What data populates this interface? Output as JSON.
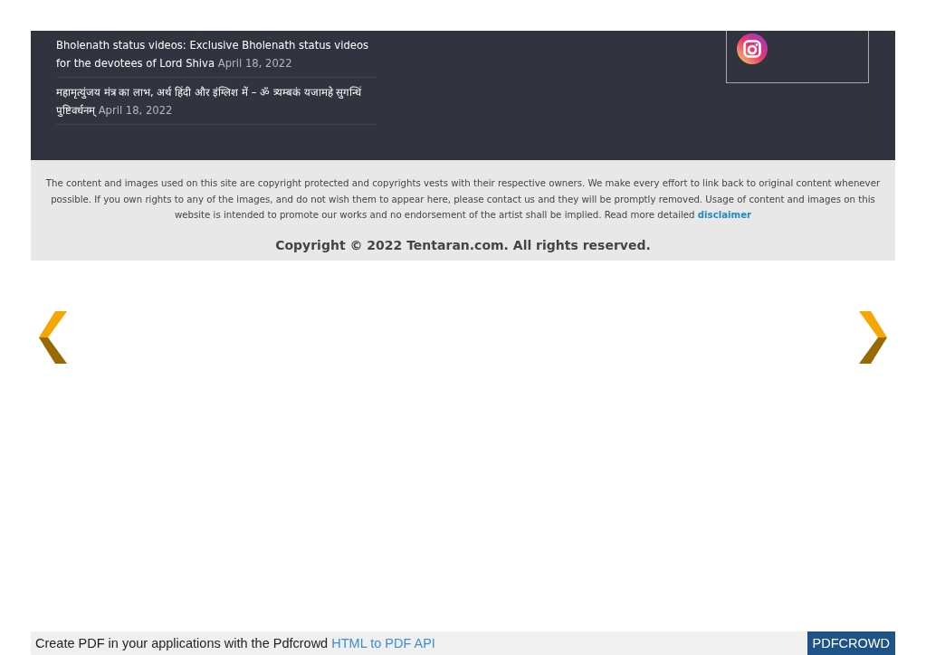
{
  "recent_posts": [
    {
      "title": "Bholenath status videos: Exclusive Bholenath status videos for the devotees of Lord Shiva",
      "date": "April 18, 2022"
    },
    {
      "title": "महामृत्युंजय मंत्र का लाभ, अर्थ हिंदी और इंग्लिश में – ॐ त्र्यम्बकं यजामहे सुगन्धिं पुष्टिवर्धनम्",
      "date": "April 18, 2022"
    }
  ],
  "disclaimer": {
    "text": "The content and images used on this site are copyright protected and copyrights vests with their respective owners. We make every effort to link back to original content whenever possible. If you own rights to any of the images, and do not wish them to appear here, please contact us and they will be promptly removed. Usage of content and images on this website is intended to promote our works and no endorsement of the artist shall be implied. Read more detailed",
    "link": "disclaimer"
  },
  "copyright": "Copyright © 2022 Tentaran.com. All rights reserved.",
  "pdf_bar": {
    "text": "Create PDF in your applications with the Pdfcrowd",
    "link": "HTML to PDF API",
    "button": "PDFCROWD"
  }
}
